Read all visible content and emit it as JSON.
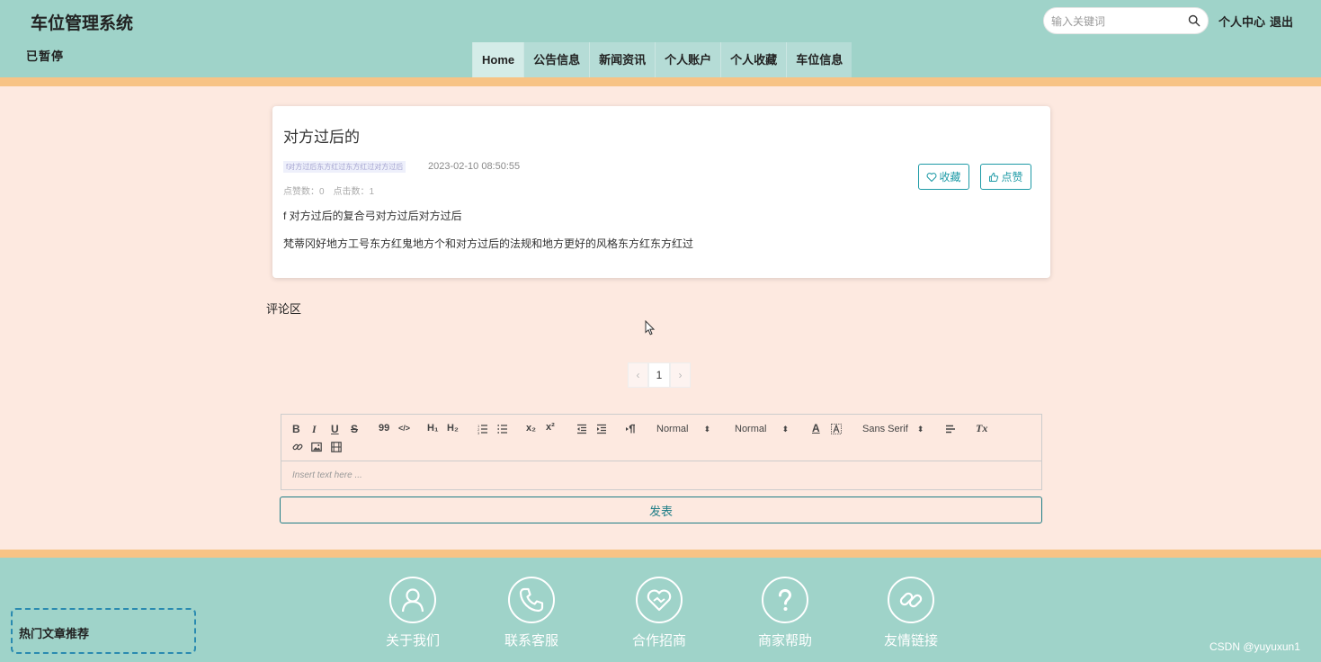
{
  "header": {
    "site_title": "车位管理系统",
    "marquee": "已暂停",
    "search_placeholder": "输入关键词",
    "user_center": "个人中心",
    "logout": "退出"
  },
  "nav": [
    {
      "label": "Home",
      "active": true
    },
    {
      "label": "公告信息"
    },
    {
      "label": "新闻资讯"
    },
    {
      "label": "个人账户"
    },
    {
      "label": "个人收藏"
    },
    {
      "label": "车位信息"
    }
  ],
  "article": {
    "title": "对方过后的",
    "tag": "f对方过后东方红过东方红过对方过后",
    "date": "2023-02-10 08:50:55",
    "stats": "点赞数：0　点击数：1",
    "paragraph1": "f 对方过后的复合弓对方过后对方过后",
    "paragraph2": "梵蒂冈好地方工号东方红鬼地方个和对方过后的法规和地方更好的风格东方红东方红过",
    "favorite_label": "收藏",
    "like_label": "点赞"
  },
  "comments": {
    "title": "评论区",
    "pager": {
      "prev": "‹",
      "current": "1",
      "next": "›"
    }
  },
  "editor": {
    "toolbar": {
      "bold": "B",
      "italic": "I",
      "underline": "U",
      "strike": "S",
      "quote": "99",
      "code": "</>",
      "h1": "H₁",
      "h2": "H₂",
      "superscript_text": "x²",
      "subscript_text": "x₂",
      "size_select": "Normal",
      "header_select": "Normal",
      "font_select": "Sans Serif",
      "color": "A",
      "clean": "Tx"
    },
    "placeholder": "Insert text here ...",
    "publish_label": "发表"
  },
  "footer": {
    "hot_articles": "热门文章推荐",
    "items": [
      {
        "label": "关于我们",
        "icon": "user-icon"
      },
      {
        "label": "联系客服",
        "icon": "phone-icon"
      },
      {
        "label": "合作招商",
        "icon": "heart-handshake-icon"
      },
      {
        "label": "商家帮助",
        "icon": "question-icon"
      },
      {
        "label": "友情链接",
        "icon": "link-icon"
      }
    ],
    "watermark": "CSDN @yuyuxun1"
  },
  "colors": {
    "header_bg": "#9fd3c9",
    "body_bg": "#fde9e0",
    "accent_orange": "#f7c385",
    "button_teal": "#1d9aa6"
  }
}
